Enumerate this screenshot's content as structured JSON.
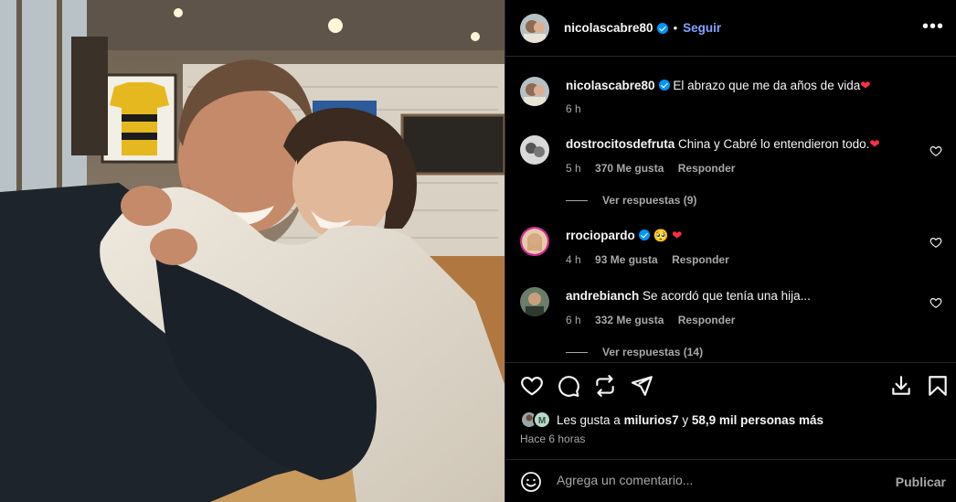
{
  "post": {
    "username": "nicolascabre80",
    "follow_label": "Seguir",
    "dot": "•",
    "more_label": "•••",
    "caption": "El abrazo que me da años de vida",
    "caption_time": "6 h"
  },
  "comments": [
    {
      "username": "dostrocitosdefruta",
      "text": "China y Cabré lo entendieron todo.",
      "emoji": "❤️",
      "time": "5 h",
      "likes": "370 Me gusta",
      "reply_label": "Responder",
      "view_replies": "Ver respuestas (9)"
    },
    {
      "username": "rrociopardo",
      "text": "🥺",
      "emoji": "❤️",
      "time": "4 h",
      "likes": "93 Me gusta",
      "reply_label": "Responder"
    },
    {
      "username": "andrebianch",
      "text": "Se acordó que tenía una hija...",
      "time": "6 h",
      "likes": "332 Me gusta",
      "reply_label": "Responder",
      "view_replies": "Ver respuestas (14)"
    }
  ],
  "likes_line": {
    "prefix": "Les gusta a",
    "user": "milurios7",
    "and": "y",
    "count": "58,9 mil personas más",
    "avatar_letter": "M"
  },
  "time_ago": "Hace 6 horas",
  "composer": {
    "placeholder": "Agrega un comentario...",
    "post_label": "Publicar"
  },
  "colors": {
    "accent_link": "#85a1ff",
    "verified": "#0095f6",
    "heart": "#ff3040",
    "muted": "#a8a8a8",
    "background": "#000000"
  },
  "icons": [
    "heart-icon",
    "comment-icon",
    "share-icon",
    "send-icon",
    "save-icon",
    "bookmark-icon",
    "emoji-icon",
    "more-icon",
    "verified-badge-icon"
  ]
}
